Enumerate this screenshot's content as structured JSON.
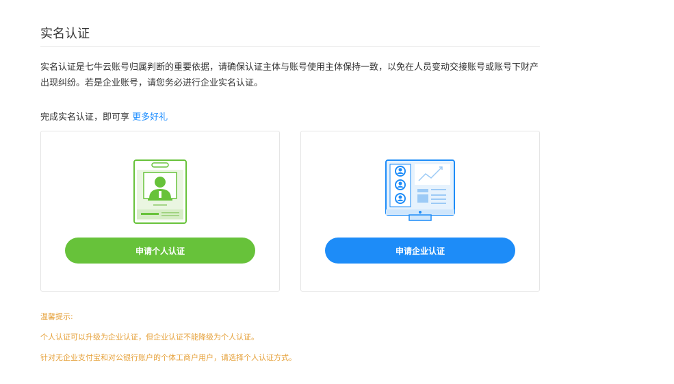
{
  "header": {
    "title": "实名认证"
  },
  "intro": {
    "text": "实名认证是七牛云账号归属判断的重要依据，请确保认证主体与账号使用主体保持一致，以免在人员变动交接账号或账号下财产出现纠纷。若是企业账号，请您务必进行企业实名认证。",
    "benefit_prefix": "完成实名认证，即可享 ",
    "benefit_link": "更多好礼"
  },
  "cards": {
    "personal": {
      "icon": "id-badge-icon",
      "button_label": "申请个人认证",
      "color": "#67c23a"
    },
    "enterprise": {
      "icon": "monitor-users-icon",
      "button_label": "申请企业认证",
      "color": "#1d8cf8"
    }
  },
  "tips": {
    "title": "温馨提示:",
    "items": [
      "个人认证可以升级为企业认证，但企业认证不能降级为个人认证。",
      "针对无企业支付宝和对公银行账户的个体工商户用户，请选择个人认证方式。"
    ],
    "color": "#e6a23c"
  }
}
